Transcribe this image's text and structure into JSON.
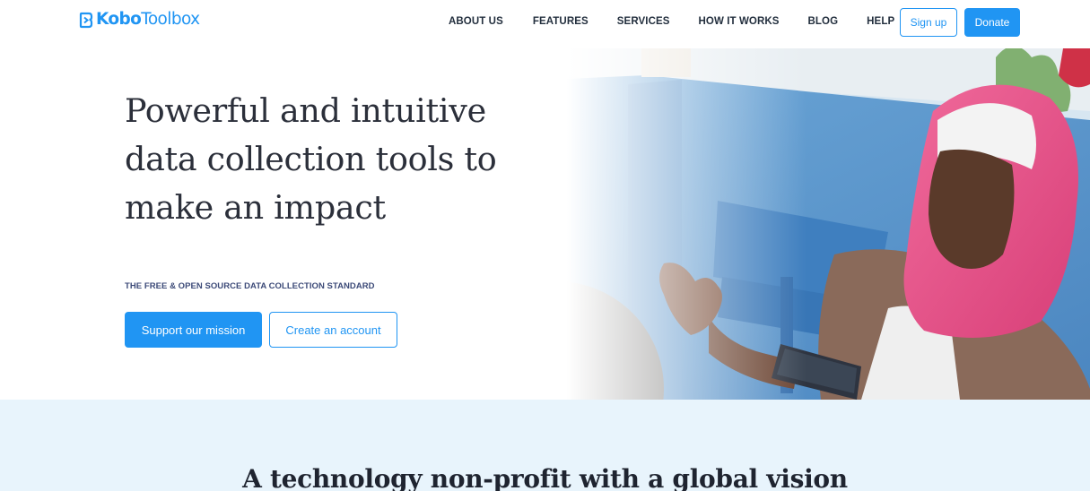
{
  "header": {
    "logo": {
      "part_bold": "Kobo",
      "part_light": "Toolbox",
      "icon": "kobo-logo-icon"
    },
    "nav": [
      {
        "label": "ABOUT US"
      },
      {
        "label": "FEATURES"
      },
      {
        "label": "SERVICES"
      },
      {
        "label": "HOW IT WORKS"
      },
      {
        "label": "BLOG"
      },
      {
        "label": "HELP"
      }
    ],
    "signup_label": "Sign up",
    "donate_label": "Donate"
  },
  "hero": {
    "title": "Powerful and intuitive data collection tools to make an impact",
    "subtitle": "THE FREE & OPEN SOURCE DATA COLLECTION STANDARD",
    "primary_button": "Support our mission",
    "secondary_button": "Create an account",
    "image": "woman-with-tablet-photo"
  },
  "vision": {
    "title": "A technology non-profit with a global vision"
  },
  "colors": {
    "brand_blue": "#2095f3",
    "nav_text": "#232f3e",
    "band_background": "#e8f4fc",
    "headline": "#2b2f3a"
  }
}
